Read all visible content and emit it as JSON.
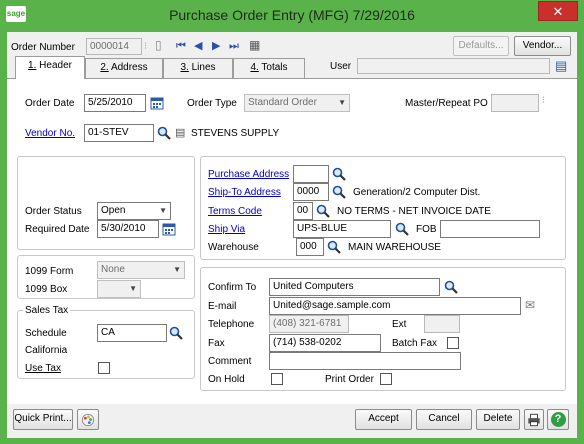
{
  "window": {
    "title": "Purchase Order Entry (MFG) 7/29/2016",
    "logo_text": "sage",
    "close_label": "✕"
  },
  "header": {
    "order_number_label": "Order Number",
    "order_number_value": "0000014",
    "defaults_label": "Defaults...",
    "vendor_btn_label": "Vendor...",
    "user_label": "User",
    "user_value": ""
  },
  "tabs": [
    {
      "num": "1.",
      "label": "Header"
    },
    {
      "num": "2.",
      "label": "Address"
    },
    {
      "num": "3.",
      "label": "Lines"
    },
    {
      "num": "4.",
      "label": "Totals"
    }
  ],
  "order": {
    "order_date_label": "Order Date",
    "order_date_value": "5/25/2010",
    "order_type_label": "Order Type",
    "order_type_value": "Standard Order",
    "master_label": "Master/Repeat PO",
    "vendor_label": "Vendor No.",
    "vendor_value": "01-STEV",
    "vendor_name": "STEVENS SUPPLY"
  },
  "status": {
    "order_status_label": "Order Status",
    "order_status_value": "Open",
    "required_date_label": "Required Date",
    "required_date_value": "5/30/2010"
  },
  "form1099": {
    "form_label": "1099 Form",
    "form_value": "None",
    "box_label": "1099 Box",
    "box_value": ""
  },
  "sales_tax": {
    "group_label": "Sales Tax",
    "schedule_label": "Schedule",
    "schedule_value": "CA",
    "schedule_desc": "California",
    "use_tax_label": "Use Tax"
  },
  "shipping": {
    "purchase_address_label": "Purchase Address",
    "purchase_address_value": "",
    "ship_to_label": "Ship-To Address",
    "ship_to_value": "0000",
    "ship_to_desc": "Generation/2 Computer Dist.",
    "terms_label": "Terms Code",
    "terms_value": "00",
    "terms_desc": "NO TERMS - NET INVOICE DATE",
    "ship_via_label": "Ship Via",
    "ship_via_value": "UPS-BLUE",
    "fob_label": "FOB",
    "fob_value": "",
    "warehouse_label": "Warehouse",
    "warehouse_value": "000",
    "warehouse_desc": "MAIN WAREHOUSE"
  },
  "contact": {
    "confirm_to_label": "Confirm To",
    "confirm_to_value": "United Computers",
    "email_label": "E-mail",
    "email_value": "United@sage.sample.com",
    "telephone_label": "Telephone",
    "telephone_value": "(408) 321-6781",
    "ext_label": "Ext",
    "ext_value": "",
    "fax_label": "Fax",
    "fax_value": "(714) 538-0202",
    "batch_fax_label": "Batch Fax",
    "comment_label": "Comment",
    "comment_value": "",
    "on_hold_label": "On Hold",
    "print_order_label": "Print Order"
  },
  "footer": {
    "quick_print_label": "Quick Print...",
    "accept_label": "Accept",
    "cancel_label": "Cancel",
    "delete_label": "Delete",
    "help_label": "?"
  },
  "colors": {
    "title_bar": "#5ab24a",
    "link": "#0000cc",
    "close": "#c9302c"
  }
}
